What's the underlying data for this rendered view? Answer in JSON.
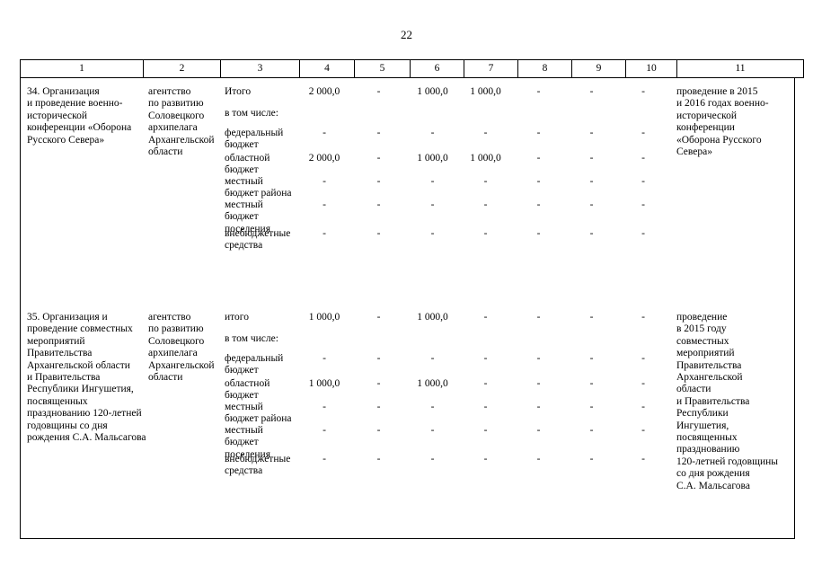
{
  "document": {
    "page_number": "22",
    "type": "budget-appendix-table"
  },
  "table": {
    "column_numbers": [
      "1",
      "2",
      "3",
      "4",
      "5",
      "6",
      "7",
      "8",
      "9",
      "10",
      "11"
    ],
    "rows": [
      {
        "id": "item-34",
        "col1": "34. Организация\nи проведение военно-\nисторической\nконференции «Оборона\nРусского Севера»",
        "col2": "агентство\nпо развитию\nСоловецкого\nархипелага\nАрхангельской\nобласти",
        "col11": "проведение в 2015\nи 2016 годах военно-\nисторической\nконференции\n«Оборона Русского\nСевера»",
        "budget_lines": [
          {
            "label": "Итого",
            "values": [
              "2 000,0",
              "-",
              "1 000,0",
              "1 000,0",
              "-",
              "-",
              "-"
            ]
          },
          {
            "label": "в том числе:",
            "values": [
              "",
              "",
              "",
              "",
              "",
              "",
              ""
            ]
          },
          {
            "label": "федеральный\nбюджет",
            "values": [
              "-",
              "-",
              "-",
              "-",
              "-",
              "-",
              "-"
            ]
          },
          {
            "label": "областной\nбюджет",
            "values": [
              "2 000,0",
              "-",
              "1 000,0",
              "1 000,0",
              "-",
              "-",
              "-"
            ]
          },
          {
            "label": "местный\nбюджет района",
            "values": [
              "-",
              "-",
              "-",
              "-",
              "-",
              "-",
              "-"
            ]
          },
          {
            "label": "местный\nбюджет\nпоселения",
            "values": [
              "-",
              "-",
              "-",
              "-",
              "-",
              "-",
              "-"
            ]
          },
          {
            "label": "внебюджетные\nсредства",
            "values": [
              "-",
              "-",
              "-",
              "-",
              "-",
              "-",
              "-"
            ]
          }
        ]
      },
      {
        "id": "item-35",
        "col1": "35. Организация и\nпроведение совместных\nмероприятий\nПравительства\nАрхангельской области\nи Правительства\nРеспублики Ингушетия,\nпосвященных\nпразднованию 120-летней\nгодовщины со дня\nрождения С.А. Мальсагова",
        "col2": "агентство\nпо развитию\nСоловецкого\nархипелага\nАрхангельской\nобласти",
        "col11": "проведение\nв 2015 году\nсовместных\nмероприятий\nПравительства\nАрхангельской\nобласти\nи Правительства\nРеспублики\nИнгушетия,\nпосвященных\nпразднованию\n120-летней годовщины\nсо дня рождения\nС.А. Мальсагова",
        "budget_lines": [
          {
            "label": "итого",
            "values": [
              "1 000,0",
              "-",
              "1 000,0",
              "-",
              "-",
              "-",
              "-"
            ]
          },
          {
            "label": "в том числе:",
            "values": [
              "",
              "",
              "",
              "",
              "",
              "",
              ""
            ]
          },
          {
            "label": "федеральный\nбюджет",
            "values": [
              "-",
              "-",
              "-",
              "-",
              "-",
              "-",
              "-"
            ]
          },
          {
            "label": "областной\nбюджет",
            "values": [
              "1 000,0",
              "-",
              "1 000,0",
              "-",
              "-",
              "-",
              "-"
            ]
          },
          {
            "label": "местный\nбюджет района",
            "values": [
              "-",
              "-",
              "-",
              "-",
              "-",
              "-",
              "-"
            ]
          },
          {
            "label": "местный\nбюджет\nпоселения",
            "values": [
              "-",
              "-",
              "-",
              "-",
              "-",
              "-",
              "-"
            ]
          },
          {
            "label": "внебюджетные\nсредства",
            "values": [
              "-",
              "-",
              "-",
              "-",
              "-",
              "-",
              "-"
            ]
          }
        ]
      }
    ]
  }
}
